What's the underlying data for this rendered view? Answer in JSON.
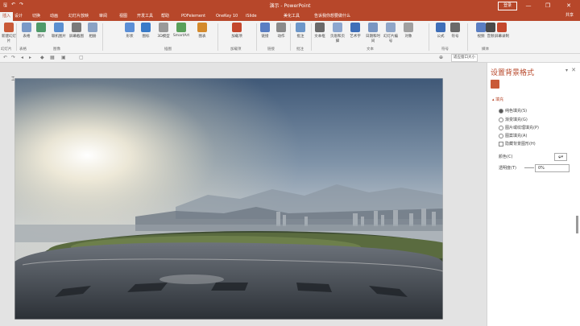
{
  "window": {
    "title": "演示 - PowerPoint",
    "signin": "登录",
    "controls": {
      "minimize": "—",
      "restore": "❐",
      "close": "✕"
    }
  },
  "tabs": [
    {
      "label": "插入",
      "active": true
    },
    {
      "label": "设计"
    },
    {
      "label": "切换"
    },
    {
      "label": "动画"
    },
    {
      "label": "幻灯片放映"
    },
    {
      "label": "审阅"
    },
    {
      "label": "视图"
    },
    {
      "label": "开发工具"
    },
    {
      "label": "帮助"
    },
    {
      "label": "PDFelement"
    },
    {
      "label": "OneKey 10"
    },
    {
      "label": "iSlide"
    },
    {
      "label": "美化工具"
    },
    {
      "label": "告诉我你想要做什么"
    }
  ],
  "share_label": "共享",
  "ribbon": {
    "buttons": [
      "新建幻灯片",
      "表格",
      "图片",
      "联机图片",
      "屏幕截图",
      "相册",
      "形状",
      "图标",
      "3D模型",
      "SmartArt",
      "图表",
      "加载项",
      "链接",
      "动作",
      "批注",
      "文本框",
      "页眉和页脚",
      "艺术字",
      "日期和时间",
      "幻灯片编号",
      "对象",
      "公式",
      "符号",
      "视频",
      "音频",
      "屏幕录制"
    ],
    "groups": [
      "幻灯片",
      "表格",
      "图像",
      "插图",
      "加载项",
      "链接",
      "批注",
      "文本",
      "符号",
      "媒体"
    ]
  },
  "toolbar": {
    "zoom_icon": "⊕",
    "fit_label": "适应窗口大小"
  },
  "pane": {
    "title": "设置背景格式",
    "section": "填充",
    "options": [
      {
        "label": "纯色填充(S)",
        "checked": true,
        "type": "radio"
      },
      {
        "label": "渐变填充(G)",
        "checked": false,
        "type": "radio"
      },
      {
        "label": "图片或纹理填充(P)",
        "checked": false,
        "type": "radio"
      },
      {
        "label": "图案填充(A)",
        "checked": false,
        "type": "radio"
      },
      {
        "label": "隐藏背景图形(H)",
        "checked": false,
        "type": "checkbox"
      }
    ],
    "color_label": "颜色(C)",
    "transparency_label": "透明度(T)",
    "transparency_value": "0%"
  },
  "colors": {
    "accent": "#b7472a",
    "ribbon": "#f3f3f3"
  }
}
